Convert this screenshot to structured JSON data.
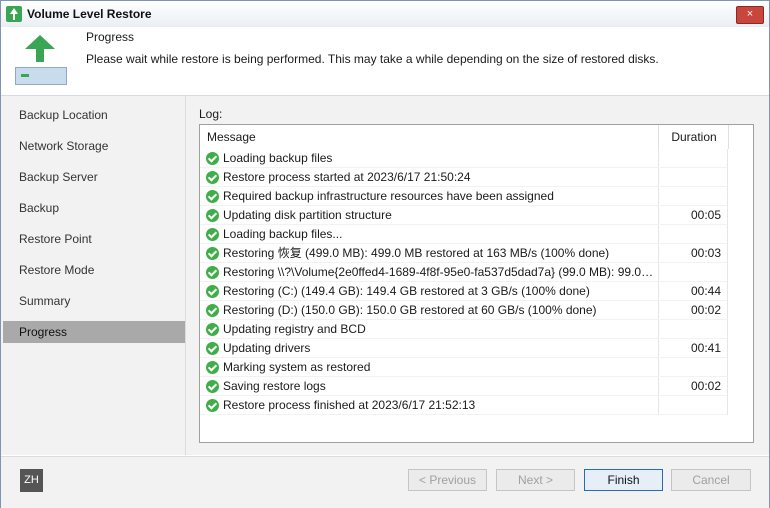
{
  "window": {
    "title": "Volume Level Restore",
    "close_icon": "×"
  },
  "header": {
    "step_title": "Progress",
    "description": "Please wait while restore is being performed. This may take a while depending on the size of restored disks."
  },
  "sidebar": {
    "items": [
      {
        "label": "Backup Location"
      },
      {
        "label": "Network Storage"
      },
      {
        "label": "Backup Server"
      },
      {
        "label": "Backup"
      },
      {
        "label": "Restore Point"
      },
      {
        "label": "Restore Mode"
      },
      {
        "label": "Summary"
      },
      {
        "label": "Progress",
        "active": true
      }
    ]
  },
  "log": {
    "label": "Log:",
    "columns": {
      "message": "Message",
      "duration": "Duration"
    },
    "rows": [
      {
        "message": "Loading backup files",
        "duration": ""
      },
      {
        "message": "Restore process started at 2023/6/17 21:50:24",
        "duration": ""
      },
      {
        "message": "Required backup infrastructure resources have been assigned",
        "duration": ""
      },
      {
        "message": "Updating disk partition structure",
        "duration": "00:05"
      },
      {
        "message": "Loading backup files...",
        "duration": ""
      },
      {
        "message": "Restoring 恢复 (499.0 MB): 499.0 MB restored at 163 MB/s (100% done)",
        "duration": "00:03"
      },
      {
        "message": "Restoring \\\\?\\Volume{2e0ffed4-1689-4f8f-95e0-fa537d5dad7a} (99.0 MB): 99.0 M...",
        "duration": ""
      },
      {
        "message": "Restoring (C:) (149.4 GB): 149.4 GB restored at 3 GB/s (100% done)",
        "duration": "00:44"
      },
      {
        "message": "Restoring (D:) (150.0 GB): 150.0 GB restored at 60 GB/s (100% done)",
        "duration": "00:02"
      },
      {
        "message": "Updating registry and BCD",
        "duration": ""
      },
      {
        "message": "Updating drivers",
        "duration": "00:41"
      },
      {
        "message": "Marking system as restored",
        "duration": ""
      },
      {
        "message": "Saving restore logs",
        "duration": "00:02"
      },
      {
        "message": "Restore process finished at 2023/6/17 21:52:13",
        "duration": ""
      }
    ]
  },
  "footer": {
    "language": "ZH",
    "previous": "< Previous",
    "next": "Next >",
    "finish": "Finish",
    "cancel": "Cancel"
  },
  "colors": {
    "success": "#3fae49",
    "active_nav": "#a9a9a9",
    "close": "#c9463d"
  }
}
